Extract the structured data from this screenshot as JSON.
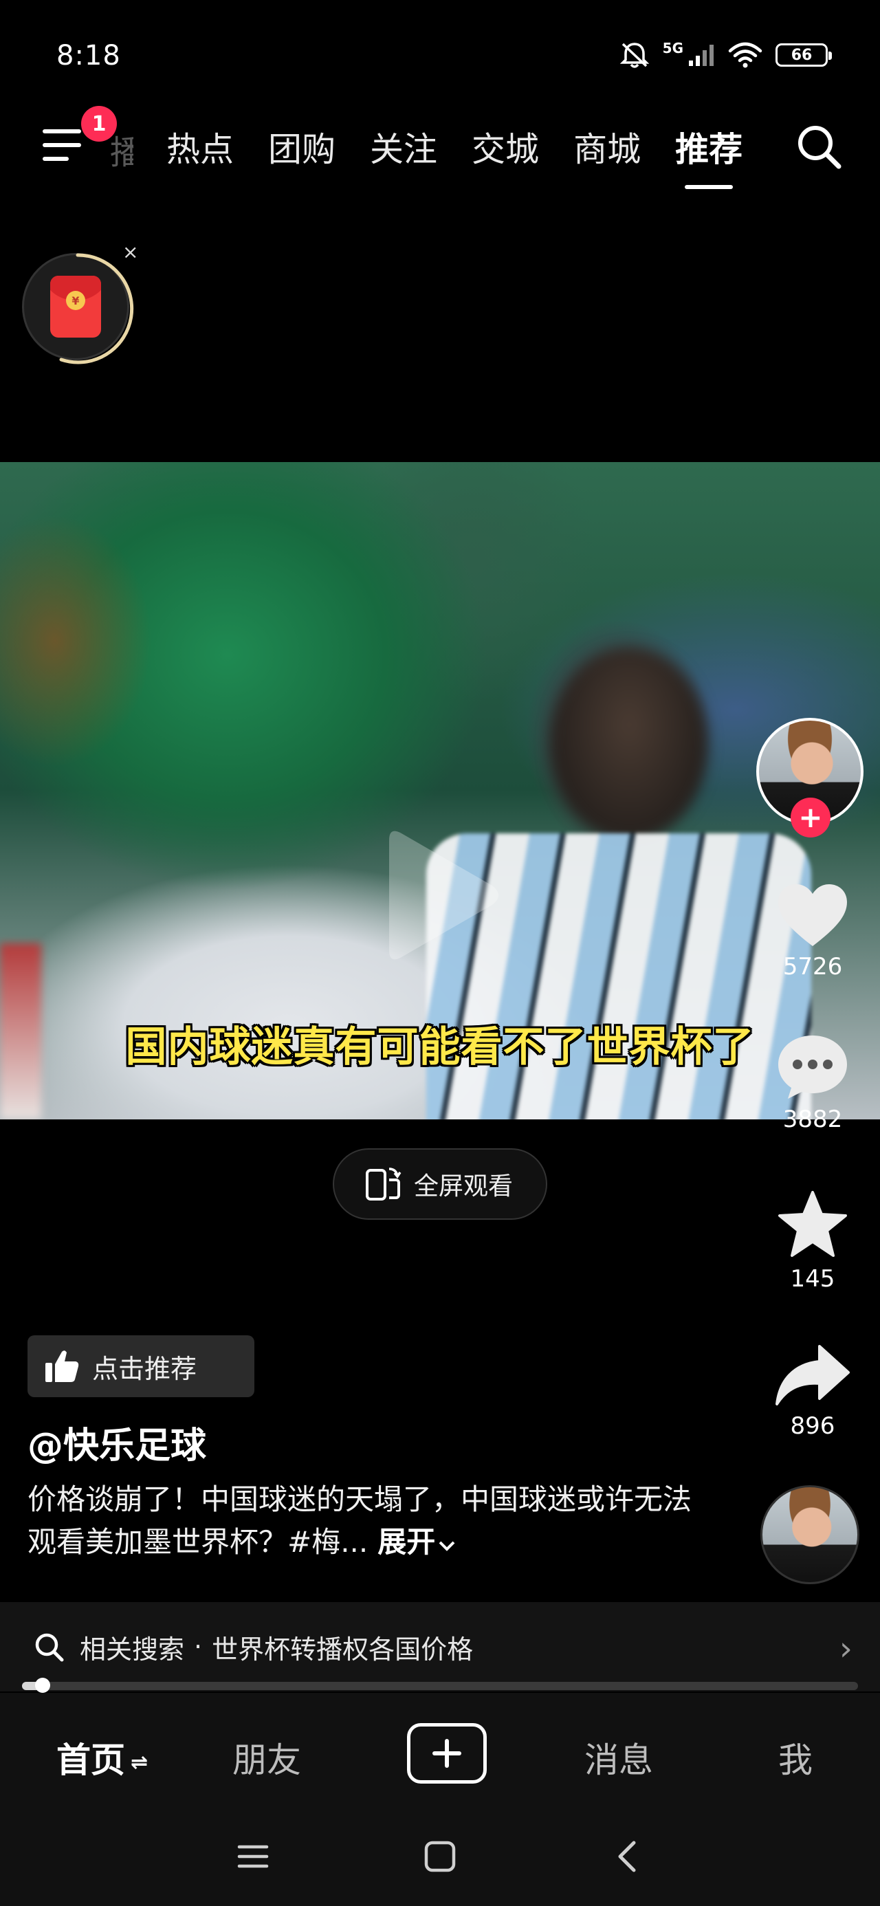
{
  "status_bar": {
    "time": "8:18",
    "network": "5G",
    "battery": "66"
  },
  "top_nav": {
    "notification_count": "1",
    "partial_tab": "播",
    "tabs": [
      "热点",
      "团购",
      "关注",
      "交城",
      "商城",
      "推荐"
    ],
    "active_tab": "推荐"
  },
  "red_packet": {
    "coin_symbol": "¥",
    "close_label": "×"
  },
  "video": {
    "subtitle": "国内球迷真有可能看不了世界杯了",
    "state": "paused"
  },
  "fullscreen": {
    "label": "全屏观看"
  },
  "actions": {
    "follow_label": "+",
    "likes": "5726",
    "comments": "3882",
    "favorites": "145",
    "shares": "896"
  },
  "post": {
    "recommend_label": "点击推荐",
    "author": "@快乐足球",
    "description": "价格谈崩了！中国球迷的天塌了，中国球迷或许无法观看美加墨世界杯？#梅...",
    "expand_label": "展开"
  },
  "related_search": {
    "prefix": "相关搜索",
    "separator": "·",
    "query": "世界杯转播权各国价格",
    "chevron": "›"
  },
  "playback": {
    "progress": 0.025
  },
  "bottom_tabs": {
    "home": "首页",
    "friends": "朋友",
    "inbox": "消息",
    "me": "我",
    "home_swap": "⇌"
  },
  "colors": {
    "accent": "#fe2c55",
    "subtitle": "#ffe84a",
    "background": "#000000"
  }
}
